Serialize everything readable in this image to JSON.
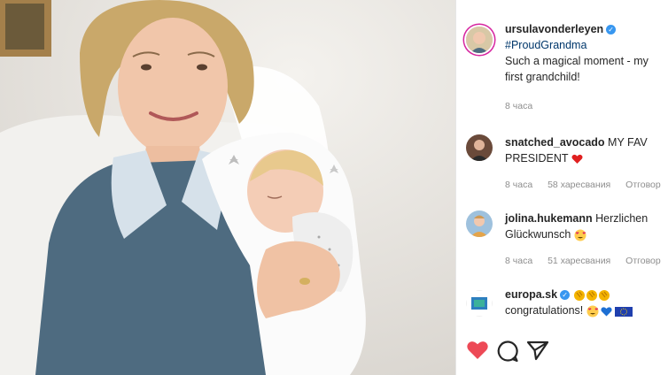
{
  "post": {
    "author": "ursulavonderleyen",
    "hashtag": "#ProudGrandma",
    "caption": "Such a magical moment - my first grandchild!",
    "time": "8 часа"
  },
  "comments": [
    {
      "user": "snatched_avocado",
      "text": "MY FAV PRESIDENT",
      "time": "8 часа",
      "likes": "58 харесвания",
      "reply": "Отговор"
    },
    {
      "user": "jolina.hukemann",
      "text": "Herzlichen Glückwunsch",
      "time": "8 часа",
      "likes": "51 харесвания",
      "reply": "Отговор"
    },
    {
      "user": "europa.sk",
      "text": "congratulations!"
    }
  ],
  "icons": {
    "verified": "verified-badge-icon",
    "like": "heart-icon",
    "comment": "comment-bubble-icon",
    "share": "send-paper-plane-icon"
  },
  "colors": {
    "like_red": "#ed4956",
    "verified_blue": "#3897f0",
    "hashtag_blue": "#00376b",
    "meta_gray": "#8e8e8e"
  }
}
